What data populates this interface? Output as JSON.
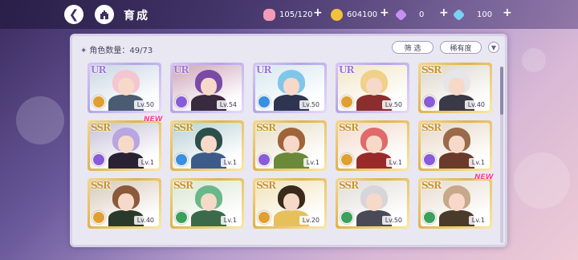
{
  "header": {
    "back_icon": "back-arrow-icon",
    "home_icon": "castle-icon",
    "title": "育成"
  },
  "resources": [
    {
      "name": "stamina",
      "icon": "candy-icon",
      "value": "105/120",
      "color": "#f29ab8"
    },
    {
      "name": "coin",
      "icon": "coin-icon",
      "value": "604100",
      "color": "#f2c23a"
    },
    {
      "name": "gem-paid",
      "icon": "gem-icon",
      "value": "0",
      "color": "#c690f0"
    },
    {
      "name": "gem-free",
      "icon": "diamond-icon",
      "value": "100",
      "color": "#7ad0f5"
    }
  ],
  "panel": {
    "count_label": "角色数量：49/73",
    "filter_label": "筛 选",
    "sort_label": "稀有度",
    "sort_icon": "chevron-down-icon"
  },
  "cards": [
    {
      "rarity": "UR",
      "level": "Lv.50",
      "attr_color": "#e0a030",
      "hair": "#f4c6d2",
      "outfit": "#4a5b72",
      "bg": "#c9d6e3",
      "new": false
    },
    {
      "rarity": "UR",
      "level": "Lv.54",
      "attr_color": "#8a5bd9",
      "hair": "#7a4aa8",
      "outfit": "#3a2a3e",
      "bg": "#cfa6b8",
      "new": false
    },
    {
      "rarity": "UR",
      "level": "Lv.50",
      "attr_color": "#3a8fe0",
      "hair": "#7fc6ea",
      "outfit": "#2f3550",
      "bg": "#d6e8f0",
      "new": false
    },
    {
      "rarity": "UR",
      "level": "Lv.50",
      "attr_color": "#e0a030",
      "hair": "#f0d08a",
      "outfit": "#8a2e2e",
      "bg": "#f2e6c8",
      "new": false
    },
    {
      "rarity": "SSR",
      "level": "Lv.40",
      "attr_color": "#8a5bd9",
      "hair": "#e6e6ea",
      "outfit": "#3a3a46",
      "bg": "#dcd6c8",
      "new": false
    },
    {
      "rarity": "SSR",
      "level": "Lv.1",
      "attr_color": "#8a5bd9",
      "hair": "#b8a6e0",
      "outfit": "#2a2234",
      "bg": "#c8c0d8",
      "new": true
    },
    {
      "rarity": "SSR",
      "level": "Lv.1",
      "attr_color": "#3a8fe0",
      "hair": "#2c4f4a",
      "outfit": "#3d5b8a",
      "bg": "#b8d0d8",
      "new": false
    },
    {
      "rarity": "SSR",
      "level": "Lv.1",
      "attr_color": "#8a5bd9",
      "hair": "#a0643a",
      "outfit": "#6a8a3a",
      "bg": "#e6dcc4",
      "new": false
    },
    {
      "rarity": "SSR",
      "level": "Lv.1",
      "attr_color": "#e0a030",
      "hair": "#e06a6a",
      "outfit": "#9a2a2a",
      "bg": "#f2d8c8",
      "new": false
    },
    {
      "rarity": "SSR",
      "level": "Lv.1",
      "attr_color": "#8a5bd9",
      "hair": "#9a6a4a",
      "outfit": "#6a3a2a",
      "bg": "#e6d6c4",
      "new": false
    },
    {
      "rarity": "SSR",
      "level": "Lv.40",
      "attr_color": "#e0a030",
      "hair": "#8a5a3a",
      "outfit": "#2a3a2a",
      "bg": "#d6c8b8",
      "new": false
    },
    {
      "rarity": "SSR",
      "level": "Lv.1",
      "attr_color": "#3aa05a",
      "hair": "#6ab88a",
      "outfit": "#3a6a4a",
      "bg": "#d8e6d0",
      "new": false
    },
    {
      "rarity": "SSR",
      "level": "Lv.20",
      "attr_color": "#e0a030",
      "hair": "#3a2a1a",
      "outfit": "#e6c05a",
      "bg": "#f0e2b8",
      "new": false
    },
    {
      "rarity": "SSR",
      "level": "Lv.50",
      "attr_color": "#3aa05a",
      "hair": "#d6d6da",
      "outfit": "#4a4a56",
      "bg": "#e0dcd6",
      "new": false
    },
    {
      "rarity": "SSR",
      "level": "Lv.1",
      "attr_color": "#3aa05a",
      "hair": "#c8a88a",
      "outfit": "#4a3a2a",
      "bg": "#e6dcd0",
      "new": true
    }
  ]
}
